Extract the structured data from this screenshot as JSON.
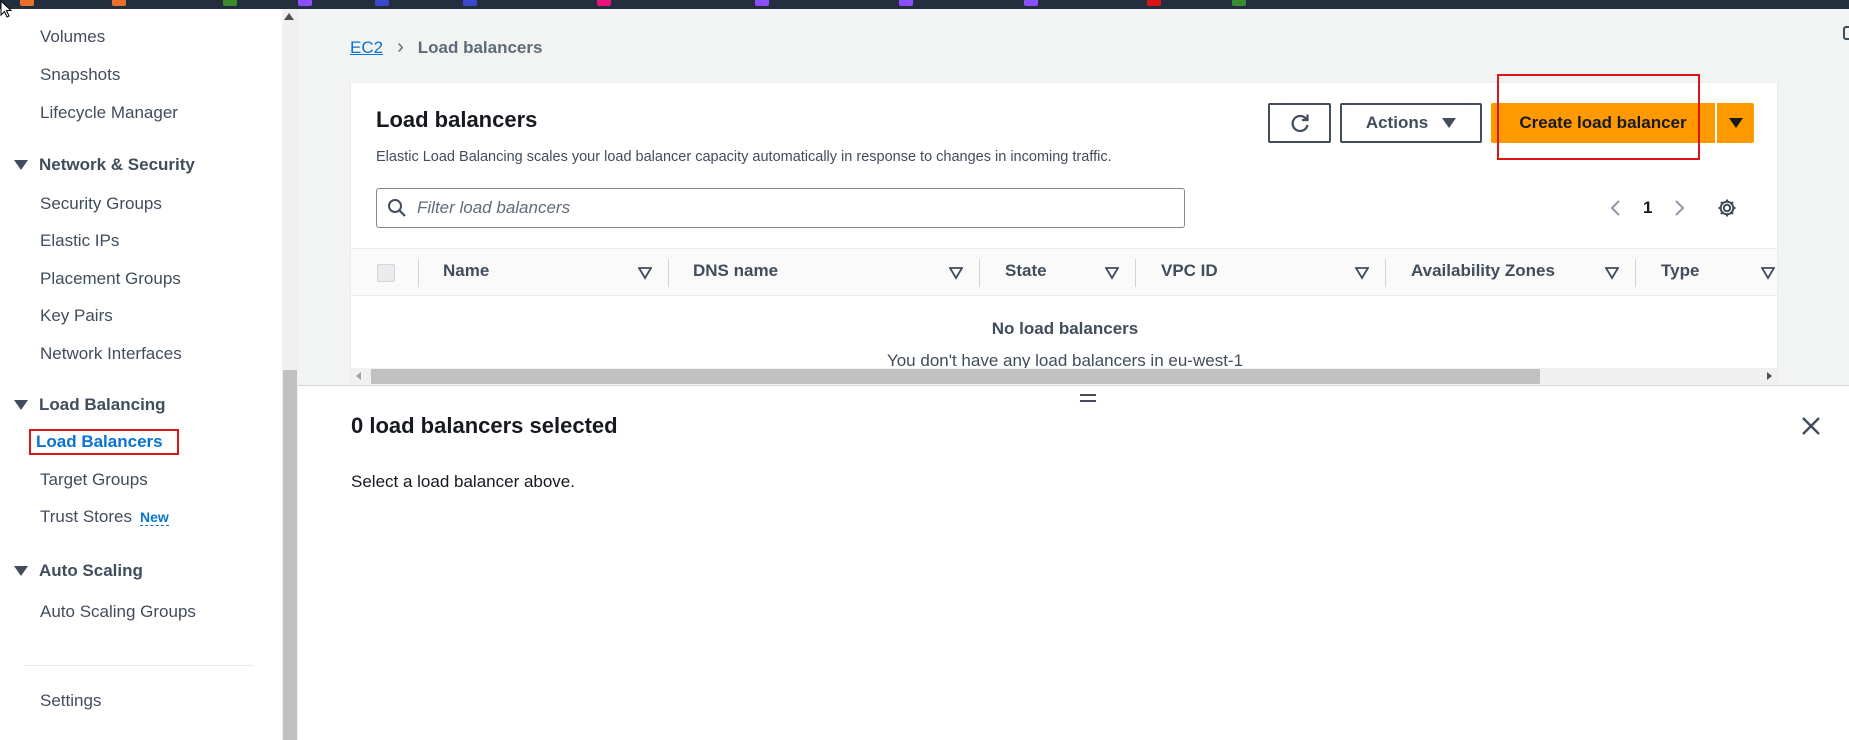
{
  "topbar": {
    "favicons": [
      {
        "color": "#e8702a"
      },
      {
        "color": "#e8702a"
      },
      {
        "color": "#3b8b2f"
      },
      {
        "color": "#8c4fff"
      },
      {
        "color": "#3b48cc"
      },
      {
        "color": "#3b48cc"
      },
      {
        "color": "#e7157b"
      },
      {
        "color": "#8c4fff"
      },
      {
        "color": "#8c4fff"
      },
      {
        "color": "#8c4fff"
      },
      {
        "color": "#d91515"
      },
      {
        "color": "#3b8b2f"
      }
    ]
  },
  "sidebar": {
    "items_top": [
      "Volumes",
      "Snapshots",
      "Lifecycle Manager"
    ],
    "network_section": "Network & Security",
    "network_items": [
      "Security Groups",
      "Elastic IPs",
      "Placement Groups",
      "Key Pairs",
      "Network Interfaces"
    ],
    "lb_section": "Load Balancing",
    "lb_items": [
      "Load Balancers",
      "Target Groups",
      "Trust Stores"
    ],
    "new_badge": "New",
    "as_section": "Auto Scaling",
    "as_items": [
      "Auto Scaling Groups"
    ],
    "settings": "Settings"
  },
  "breadcrumb": {
    "root": "EC2",
    "current": "Load balancers"
  },
  "panel": {
    "title": "Load balancers",
    "description": "Elastic Load Balancing scales your load balancer capacity automatically in response to changes in incoming traffic.",
    "actions_label": "Actions",
    "create_label": "Create load balancer",
    "filter_placeholder": "Filter load balancers",
    "page": "1",
    "columns": [
      "Name",
      "DNS name",
      "State",
      "VPC ID",
      "Availability Zones",
      "Type"
    ],
    "empty_title": "No load balancers",
    "empty_desc": "You don't have any load balancers in eu-west-1"
  },
  "split_panel": {
    "title": "0 load balancers selected",
    "description": "Select a load balancer above."
  },
  "colors": {
    "accent": "#0972d3",
    "primary_button": "#ff9900",
    "highlight": "#d91515"
  }
}
